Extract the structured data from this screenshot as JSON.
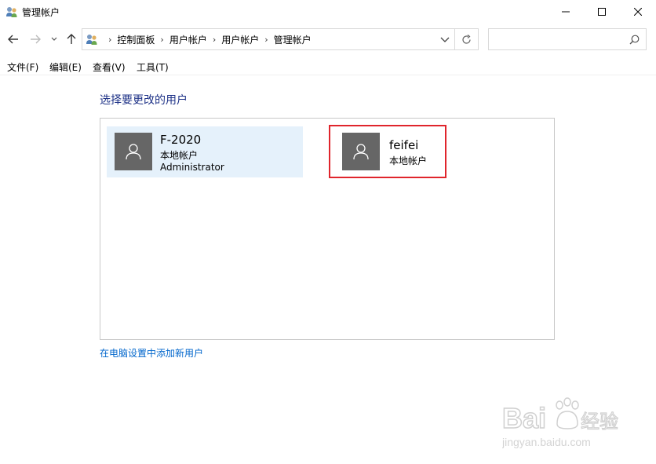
{
  "window": {
    "title": "管理帐户"
  },
  "navigation": {
    "breadcrumbs": [
      "控制面板",
      "用户帐户",
      "用户帐户",
      "管理帐户"
    ],
    "search_placeholder": ""
  },
  "menu": {
    "items": [
      "文件(F)",
      "编辑(E)",
      "查看(V)",
      "工具(T)"
    ]
  },
  "content": {
    "heading": "选择要更改的用户",
    "users": [
      {
        "name": "F-2020",
        "type": "本地帐户",
        "role": "Administrator"
      },
      {
        "name": "feifei",
        "type": "本地帐户"
      }
    ],
    "add_user_link": "在电脑设置中添加新用户"
  },
  "watermark": {
    "brand": "Baidu经验",
    "url": "jingyan.baidu.com"
  },
  "colors": {
    "heading": "#1e3287",
    "link": "#0066cc",
    "selected_tile_bg": "#e5f1fb",
    "highlight_box": "#e0252c",
    "avatar_bg": "#666666"
  }
}
